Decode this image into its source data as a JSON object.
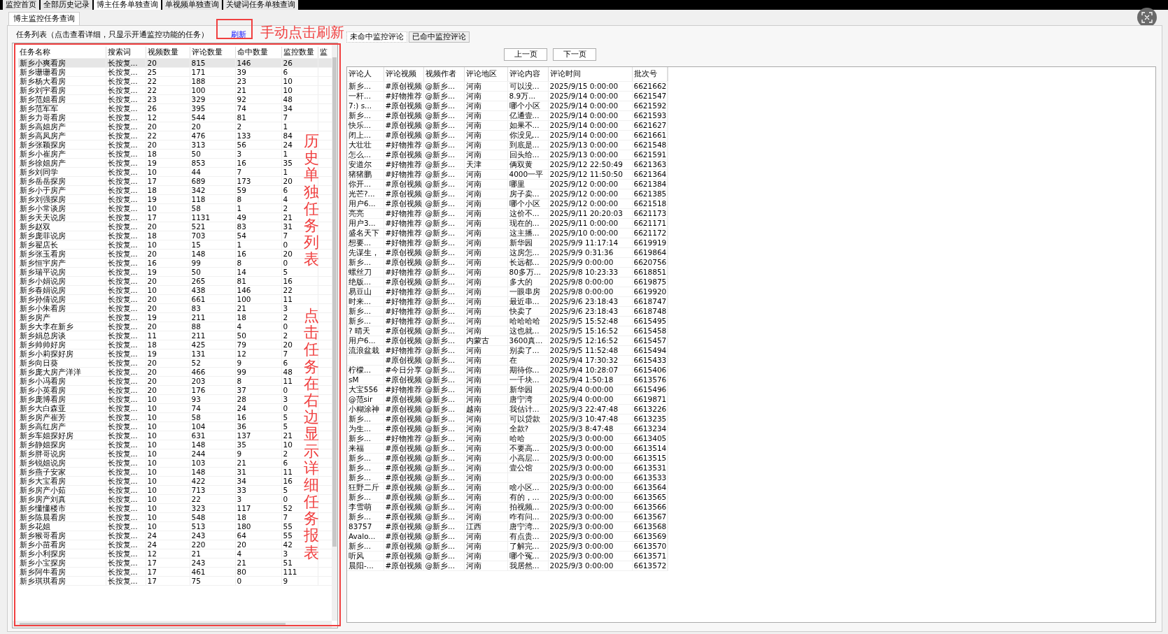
{
  "top_tabs": [
    {
      "label": "监控首页",
      "selected": false
    },
    {
      "label": "全部历史记录",
      "selected": false
    },
    {
      "label": "博主任务单独查询",
      "selected": true
    },
    {
      "label": "单视频单独查询",
      "selected": false
    },
    {
      "label": "关键词任务单独查询",
      "selected": false
    }
  ],
  "sub_tab": {
    "label": "博主监控任务查询",
    "selected": true
  },
  "task_list": {
    "legend": "任务列表（点击查看详细，只显示开通监控功能的任务）",
    "refresh_link": "刷新",
    "columns": [
      "任务名称",
      "搜索词",
      "视频数量",
      "评论数量",
      "命中数量",
      "监控数量",
      "监"
    ],
    "rows": [
      {
        "cells": [
          "新乡小爽看房",
          "长按复...",
          "20",
          "815",
          "146",
          "26"
        ],
        "selected": true
      },
      {
        "cells": [
          "新乡珊珊看房",
          "长按复...",
          "25",
          "171",
          "39",
          "6"
        ],
        "selected": false
      },
      {
        "cells": [
          "新乡杨大看房",
          "长按复...",
          "22",
          "188",
          "23",
          "10"
        ],
        "selected": false
      },
      {
        "cells": [
          "新乡刘宇看房",
          "长按复...",
          "22",
          "100",
          "21",
          "10"
        ],
        "selected": false
      },
      {
        "cells": [
          "新乡范姐看房",
          "长按复...",
          "23",
          "329",
          "92",
          "48"
        ],
        "selected": false
      },
      {
        "cells": [
          "新乡范军军",
          "长按复...",
          "26",
          "395",
          "74",
          "34"
        ],
        "selected": false
      },
      {
        "cells": [
          "新乡力哥看房",
          "长按复...",
          "12",
          "544",
          "81",
          "7"
        ],
        "selected": false
      },
      {
        "cells": [
          "新乡高姐房产",
          "长按复...",
          "20",
          "20",
          "2",
          "1"
        ],
        "selected": false
      },
      {
        "cells": [
          "新乡高凤房产",
          "长按复...",
          "22",
          "476",
          "133",
          "84"
        ],
        "selected": false
      },
      {
        "cells": [
          "新乡张颖探房",
          "长按复...",
          "20",
          "313",
          "56",
          "24"
        ],
        "selected": false
      },
      {
        "cells": [
          "新乡小崔房产",
          "长按复...",
          "18",
          "50",
          "3",
          "1"
        ],
        "selected": false
      },
      {
        "cells": [
          "新乡徐姐房产",
          "长按复...",
          "19",
          "853",
          "16",
          "35"
        ],
        "selected": false
      },
      {
        "cells": [
          "新乡刘同学",
          "长按复...",
          "10",
          "44",
          "7",
          "1"
        ],
        "selected": false
      },
      {
        "cells": [
          "新乡岳岳探房",
          "长按复...",
          "17",
          "689",
          "173",
          "20"
        ],
        "selected": false
      },
      {
        "cells": [
          "新乡小于房产",
          "长按复...",
          "18",
          "342",
          "59",
          "6"
        ],
        "selected": false
      },
      {
        "cells": [
          "新乡刘强探房",
          "长按复...",
          "19",
          "118",
          "8",
          "4"
        ],
        "selected": false
      },
      {
        "cells": [
          "新乡小常谈房",
          "长按复...",
          "10",
          "58",
          "1",
          "2"
        ],
        "selected": false
      },
      {
        "cells": [
          "新乡天天说房",
          "长按复...",
          "17",
          "1131",
          "49",
          "21"
        ],
        "selected": false
      },
      {
        "cells": [
          "新乡赵双",
          "长按复...",
          "20",
          "521",
          "83",
          "31"
        ],
        "selected": false
      },
      {
        "cells": [
          "新乡庞菲说房",
          "长按复...",
          "18",
          "703",
          "54",
          "7"
        ],
        "selected": false
      },
      {
        "cells": [
          "新乡翟店长",
          "长按复...",
          "10",
          "15",
          "1",
          "0"
        ],
        "selected": false
      },
      {
        "cells": [
          "新乡张玉看房",
          "长按复...",
          "20",
          "148",
          "16",
          "20"
        ],
        "selected": false
      },
      {
        "cells": [
          "新乡恒宇房产",
          "长按复...",
          "16",
          "99",
          "8",
          "0"
        ],
        "selected": false
      },
      {
        "cells": [
          "新乡瑞平说房",
          "长按复...",
          "19",
          "50",
          "14",
          "5"
        ],
        "selected": false
      },
      {
        "cells": [
          "新乡小娟说房",
          "长按复...",
          "20",
          "265",
          "81",
          "16"
        ],
        "selected": false
      },
      {
        "cells": [
          "新乡春娟说房",
          "长按复...",
          "10",
          "438",
          "146",
          "22"
        ],
        "selected": false
      },
      {
        "cells": [
          "新乡孙倩说房",
          "长按复...",
          "20",
          "661",
          "100",
          "11"
        ],
        "selected": false
      },
      {
        "cells": [
          "新乡小朱看房",
          "长按复...",
          "20",
          "83",
          "21",
          "3"
        ],
        "selected": false
      },
      {
        "cells": [
          "新乡房产",
          "长按复...",
          "19",
          "211",
          "18",
          "2"
        ],
        "selected": false
      },
      {
        "cells": [
          "新乡大李在新乡",
          "长按复...",
          "20",
          "88",
          "4",
          "0"
        ],
        "selected": false
      },
      {
        "cells": [
          "新乡娟总房谈",
          "长按复...",
          "11",
          "211",
          "50",
          "2"
        ],
        "selected": false
      },
      {
        "cells": [
          "新乡帅帅好房",
          "长按复...",
          "18",
          "425",
          "79",
          "20"
        ],
        "selected": false
      },
      {
        "cells": [
          "新乡小莉探好房",
          "长按复...",
          "19",
          "131",
          "12",
          "7"
        ],
        "selected": false
      },
      {
        "cells": [
          "新乡向日葵",
          "长按复...",
          "20",
          "52",
          "9",
          "6"
        ],
        "selected": false
      },
      {
        "cells": [
          "新乡庞大房产洋洋",
          "长按复...",
          "20",
          "466",
          "99",
          "48"
        ],
        "selected": false
      },
      {
        "cells": [
          "新乡小冯看房",
          "长按复...",
          "20",
          "203",
          "8",
          "11"
        ],
        "selected": false
      },
      {
        "cells": [
          "新乡小英看房",
          "长按复...",
          "20",
          "176",
          "37",
          "0"
        ],
        "selected": false
      },
      {
        "cells": [
          "新乡庞博看房",
          "长按复...",
          "10",
          "93",
          "28",
          "3"
        ],
        "selected": false
      },
      {
        "cells": [
          "新乡大白森亚",
          "长按复...",
          "10",
          "74",
          "24",
          "0"
        ],
        "selected": false
      },
      {
        "cells": [
          "新乡房产崔芳",
          "长按复...",
          "10",
          "58",
          "16",
          "5"
        ],
        "selected": false
      },
      {
        "cells": [
          "新乡高红房产",
          "长按复...",
          "10",
          "104",
          "36",
          "5"
        ],
        "selected": false
      },
      {
        "cells": [
          "新乡车姐探好房",
          "长按复...",
          "10",
          "631",
          "137",
          "21"
        ],
        "selected": false
      },
      {
        "cells": [
          "新乡静姐探房",
          "长按复...",
          "10",
          "148",
          "35",
          "10"
        ],
        "selected": false
      },
      {
        "cells": [
          "新乡胖哥说房",
          "长按复...",
          "10",
          "244",
          "9",
          "2"
        ],
        "selected": false
      },
      {
        "cells": [
          "新乡锐姐说房",
          "长按复...",
          "10",
          "103",
          "21",
          "6"
        ],
        "selected": false
      },
      {
        "cells": [
          "新乡燕子安家",
          "长按复...",
          "10",
          "148",
          "31",
          "11"
        ],
        "selected": false
      },
      {
        "cells": [
          "新乡大宝看房",
          "长按复...",
          "10",
          "422",
          "34",
          "16"
        ],
        "selected": false
      },
      {
        "cells": [
          "新乡房产小茹",
          "长按复...",
          "10",
          "713",
          "33",
          "5"
        ],
        "selected": false
      },
      {
        "cells": [
          "新乡房产刘真",
          "长按复...",
          "10",
          "22",
          "3",
          "0"
        ],
        "selected": false
      },
      {
        "cells": [
          "新乡懂懂楼市",
          "长按复...",
          "10",
          "323",
          "117",
          "52"
        ],
        "selected": false
      },
      {
        "cells": [
          "新乡陈晨看房",
          "长按复...",
          "10",
          "548",
          "18",
          "7"
        ],
        "selected": false
      },
      {
        "cells": [
          "新乡花姐",
          "长按复...",
          "10",
          "513",
          "180",
          "55"
        ],
        "selected": false
      },
      {
        "cells": [
          "新乡猴哥看房",
          "长按复...",
          "24",
          "243",
          "64",
          "55"
        ],
        "selected": false
      },
      {
        "cells": [
          "新乡小苗看房",
          "长按复...",
          "24",
          "220",
          "20",
          "42"
        ],
        "selected": false
      },
      {
        "cells": [
          "新乡小利探房",
          "长按复...",
          "12",
          "21",
          "4",
          "3"
        ],
        "selected": false
      },
      {
        "cells": [
          "新乡小宝探房",
          "长按复...",
          "17",
          "243",
          "21",
          "51"
        ],
        "selected": false
      },
      {
        "cells": [
          "新乡阿牛看房",
          "长按复...",
          "17",
          "461",
          "80",
          "111"
        ],
        "selected": false
      },
      {
        "cells": [
          "新乡琪琪看房",
          "长按复...",
          "17",
          "75",
          "0",
          "9"
        ],
        "selected": false
      }
    ]
  },
  "comment_tabs": [
    {
      "label": "未命中监控评论",
      "selected": true
    },
    {
      "label": "已命中监控评论",
      "selected": false
    }
  ],
  "pager": {
    "prev": "上一页",
    "next": "下一页"
  },
  "comments": {
    "columns": [
      "评论人",
      "评论视频",
      "视频作者",
      "评论地区",
      "评论内容",
      "评论时间",
      "批次号"
    ],
    "rows": [
      [
        "新乡...",
        "#原创视频",
        "@新乡...",
        "河南",
        "可以没...",
        "2025/9/15 0:00:00",
        "6621662"
      ],
      [
        "一杆...",
        "#好物推荐",
        "@新乡...",
        "河南",
        "8.9万...",
        "2025/9/14 0:00:00",
        "6621547"
      ],
      [
        "7:) s...",
        "#原创视频",
        "@新乡...",
        "河南",
        "哪个小区",
        "2025/9/14 0:00:00",
        "6621592"
      ],
      [
        "新乡...",
        "#原创视频",
        "@新乡...",
        "河南",
        "亿通壹...",
        "2025/9/14 0:00:00",
        "6621593"
      ],
      [
        "快乐...",
        "#原创视频",
        "@新乡...",
        "河南",
        "如果不...",
        "2025/9/14 0:00:00",
        "6621627"
      ],
      [
        "闭上...",
        "#原创视频",
        "@新乡...",
        "河南",
        "你没见...",
        "2025/9/14 0:00:00",
        "6621661"
      ],
      [
        "大壮壮",
        "#好物推荐",
        "@新乡...",
        "河南",
        "到底是...",
        "2025/9/13 0:00:00",
        "6621548"
      ],
      [
        "怎么...",
        "#原创视频",
        "@新乡...",
        "河南",
        "回头给...",
        "2025/9/13 0:00:00",
        "6621591"
      ],
      [
        "安道尔",
        "#好物推荐",
        "@新乡...",
        "天津",
        "俩双黄",
        "2025/9/12 22:50:49",
        "6621363"
      ],
      [
        "猪猪鹏",
        "#好物推荐",
        "@新乡...",
        "河南",
        "4000一平",
        "2025/9/12 11:50:50",
        "6621364"
      ],
      [
        "你开...",
        "#原创视频",
        "@新乡...",
        "河南",
        "哪里",
        "2025/9/12 0:00:00",
        "6621384"
      ],
      [
        "光芒?...",
        "#原创视频",
        "@新乡...",
        "河南",
        "房子卖...",
        "2025/9/12 0:00:00",
        "6621385"
      ],
      [
        "用户6...",
        "#原创视频",
        "@新乡...",
        "河南",
        "哪个小区",
        "2025/9/12 0:00:00",
        "6621518"
      ],
      [
        "亮亮",
        "#好物推荐",
        "@新乡...",
        "河南",
        "这价不...",
        "2025/9/11 20:20:03",
        "6621173"
      ],
      [
        "用户3...",
        "#好物推荐",
        "@新乡...",
        "河南",
        "现在的...",
        "2025/9/11 0:00:00",
        "6621171"
      ],
      [
        "盛名天下",
        "#好物推荐",
        "@新乡...",
        "河南",
        "这主播...",
        "2025/9/10 0:00:00",
        "6621172"
      ],
      [
        "想要...",
        "#好物推荐",
        "@新乡...",
        "河南",
        "新华园",
        "2025/9/9 11:17:14",
        "6619919"
      ],
      [
        "先谋生，",
        "#原创视频",
        "@新乡...",
        "河南",
        "这房怎...",
        "2025/9/9 0:31:36",
        "6619864"
      ],
      [
        "新乡...",
        "#原创视频",
        "@新乡...",
        "河南",
        "长远都...",
        "2025/9/9 0:00:00",
        "6620756"
      ],
      [
        "螺丝刀",
        "#好物推荐",
        "@新乡...",
        "河南",
        "80多万...",
        "2025/9/8 10:23:33",
        "6618851"
      ],
      [
        "绝版...",
        "#原创视频",
        "@新乡...",
        "河南",
        "多大的",
        "2025/9/8 0:00:00",
        "6619875"
      ],
      [
        "易豆山",
        "#好物推荐",
        "@新乡...",
        "河南",
        "一眼串房",
        "2025/9/8 0:00:00",
        "6619920"
      ],
      [
        "时来...",
        "#好物推荐",
        "@新乡...",
        "河南",
        "最近串...",
        "2025/9/6 23:18:43",
        "6618747"
      ],
      [
        "新乡...",
        "#好物推荐",
        "@新乡...",
        "河南",
        "快卖了",
        "2025/9/6 23:18:43",
        "6618748"
      ],
      [
        "新乡...",
        "#好物推荐",
        "@新乡...",
        "河南",
        "哈哈哈哈",
        "2025/9/5 15:52:48",
        "6615495"
      ],
      [
        "? 晴天",
        "#原创视频",
        "@新乡...",
        "河南",
        "这也就...",
        "2025/9/5 15:16:52",
        "6615458"
      ],
      [
        "用户6...",
        "#原创视频",
        "@新乡...",
        "内蒙古",
        "3600真...",
        "2025/9/5 12:16:52",
        "6615457"
      ],
      [
        "流浪盆栽",
        "#好物推荐",
        "@新乡...",
        "河南",
        "别卖了...",
        "2025/9/5 11:52:48",
        "6615494"
      ],
      [
        null,
        "#原创视频",
        "@新乡...",
        "河南",
        "在",
        "2025/9/4 17:30:32",
        "6615433"
      ],
      [
        "柠檬...",
        "#今日分享",
        "@新乡...",
        "河南",
        "期待你...",
        "2025/9/4 10:28:07",
        "6615406"
      ],
      [
        "sM",
        "#原创视频",
        "@新乡...",
        "河南",
        "一千块...",
        "2025/9/4 1:50:18",
        "6613576"
      ],
      [
        "大宝556",
        "#好物推荐",
        "@新乡...",
        "河南",
        "新华园",
        "2025/9/4 0:00:00",
        "6615496"
      ],
      [
        "@范sir",
        "#原创视频",
        "@新乡...",
        "河南",
        "唐宁湾",
        "2025/9/4 0:00:00",
        "6619871"
      ],
      [
        "小糊涂神",
        "#原创视频",
        "@新乡...",
        "越南",
        "我估计...",
        "2025/9/3 22:47:48",
        "6613226"
      ],
      [
        "新乡...",
        "#原创视频",
        "@新乡...",
        "河南",
        "可以贷款",
        "2025/9/3 10:47:48",
        "6613235"
      ],
      [
        "为生...",
        "#原创视频",
        "@新乡...",
        "河南",
        "全款?",
        "2025/9/3 8:47:48",
        "6613234"
      ],
      [
        "新乡...",
        "#好物推荐",
        "@新乡...",
        "河南",
        "哈哈",
        "2025/9/3 0:00:00",
        "6613405"
      ],
      [
        "来福",
        "#原创视频",
        "@新乡...",
        "河南",
        "不要高...",
        "2025/9/3 0:00:00",
        "6613514"
      ],
      [
        "新乡...",
        "#原创视频",
        "@新乡...",
        "河南",
        "小高层...",
        "2025/9/3 0:00:00",
        "6613515"
      ],
      [
        "新乡...",
        "#原创视频",
        "@新乡...",
        "河南",
        "壹公馆",
        "2025/9/3 0:00:00",
        "6613531"
      ],
      [
        "新乡...",
        "#原创视频",
        "@新乡...",
        "河南",
        null,
        "2025/9/3 0:00:00",
        "6613533"
      ],
      [
        "狂野二斤",
        "#原创视频",
        "@新乡...",
        "河南",
        "啥小区...",
        "2025/9/3 0:00:00",
        "6613564"
      ],
      [
        "新乡...",
        "#原创视频",
        "@新乡...",
        "河南",
        "有的，...",
        "2025/9/3 0:00:00",
        "6613565"
      ],
      [
        "李雪萌",
        "#原创视频",
        "@新乡...",
        "河南",
        "拍视频...",
        "2025/9/3 0:00:00",
        "6613566"
      ],
      [
        "新乡...",
        "#原创视频",
        "@新乡...",
        "河南",
        "咋有问...",
        "2025/9/3 0:00:00",
        "6613567"
      ],
      [
        "83757",
        "#原创视频",
        "@新乡...",
        "江西",
        "唐宁湾...",
        "2025/9/3 0:00:00",
        "6613568"
      ],
      [
        "Avalo...",
        "#原创视频",
        "@新乡...",
        "河南",
        "有点贵...",
        "2025/9/3 0:00:00",
        "6613569"
      ],
      [
        "新乡...",
        "#原创视频",
        "@新乡...",
        "河南",
        "了解完...",
        "2025/9/3 0:00:00",
        "6613570"
      ],
      [
        "听风",
        "#原创视频",
        "@新乡...",
        "河南",
        "哪个冤...",
        "2025/9/3 0:00:00",
        "6613571"
      ],
      [
        "晨阳-...",
        "#原创视频",
        "@新乡...",
        "河南",
        "我居然...",
        "2025/9/3 0:00:00",
        "6613572"
      ]
    ]
  },
  "annotations": [
    {
      "kind": "horizontal",
      "text": "手动点击刷新"
    },
    {
      "kind": "vertical",
      "text": "历史单独任务列表"
    },
    {
      "kind": "vertical",
      "text": "点击任务在右边显示详细任务报表"
    }
  ]
}
